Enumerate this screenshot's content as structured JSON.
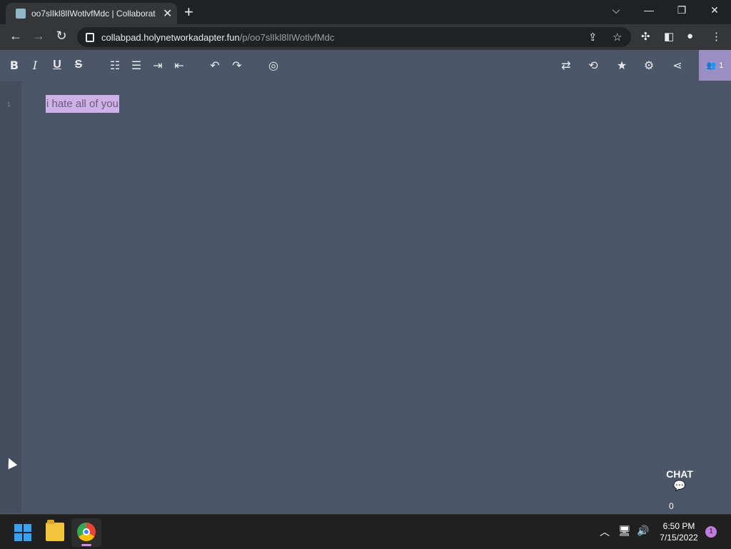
{
  "browser": {
    "tab_title": "oo7slIkl8lIWotlvfMdc | Collaborat",
    "new_tab": "+",
    "url_domain": "collabpad.holynetworkadapter.fun",
    "url_path": "/p/oo7slIkl8lIWotlvfMdc",
    "window_controls": {
      "dropdown": "⌵",
      "minimize": "—",
      "maximize": "❐",
      "close": "✕"
    }
  },
  "toolbar": {
    "bold": "B",
    "italic": "I",
    "underline": "U",
    "strike": "S",
    "ordered_list": "☷",
    "unordered_list": "☰",
    "indent": "⇥",
    "outdent": "⇤",
    "undo": "↶",
    "redo": "↷",
    "hide_authorship": "◎",
    "import_export": "⇄",
    "history": "⟲",
    "star": "★",
    "settings": "⚙",
    "share": "⋖",
    "users_count": "1"
  },
  "editor": {
    "line_number": "1",
    "text": "i hate all of you"
  },
  "chat": {
    "label": "CHAT",
    "count": "0"
  },
  "taskbar": {
    "time": "6:50 PM",
    "date": "7/15/2022",
    "notification_count": "1"
  }
}
